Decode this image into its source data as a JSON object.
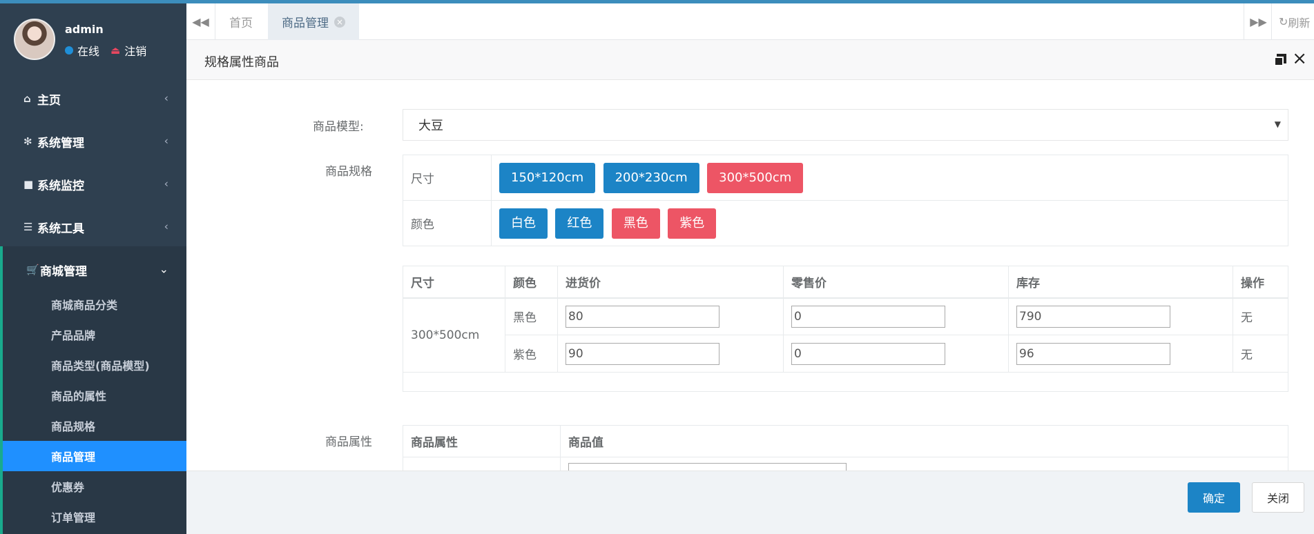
{
  "colors": {
    "sidebar_bg": "#2f4050",
    "active_item": "#1f90ff",
    "primary_button": "#1c84c6",
    "danger_button": "#ed5565"
  },
  "user": {
    "name": "admin",
    "status_online": "在线",
    "logout": "注销"
  },
  "sidebar": {
    "items": [
      {
        "label": "主页",
        "icon": "home-icon"
      },
      {
        "label": "系统管理",
        "icon": "gear-icon"
      },
      {
        "label": "系统监控",
        "icon": "video-camera-icon"
      },
      {
        "label": "系统工具",
        "icon": "list-icon"
      },
      {
        "label": "商城管理",
        "icon": "cart-icon"
      }
    ],
    "sub_items": [
      {
        "label": "商城商品分类"
      },
      {
        "label": "产品品牌"
      },
      {
        "label": "商品类型(商品模型)"
      },
      {
        "label": "商品的属性"
      },
      {
        "label": "商品规格"
      },
      {
        "label": "商品管理",
        "active": true
      },
      {
        "label": "优惠券"
      },
      {
        "label": "订单管理"
      }
    ]
  },
  "tabs": [
    {
      "label": "首页"
    },
    {
      "label": "商品管理",
      "active": true
    }
  ],
  "refresh_label": "刷新",
  "dialog": {
    "title": "规格属性商品",
    "model_label": "商品模型:",
    "model_value": "大豆",
    "spec_label": "商品规格",
    "specs": [
      {
        "name": "尺寸",
        "values": [
          {
            "label": "150*120cm",
            "selected": false
          },
          {
            "label": "200*230cm",
            "selected": false
          },
          {
            "label": "300*500cm",
            "selected": true
          }
        ]
      },
      {
        "name": "颜色",
        "values": [
          {
            "label": "白色",
            "selected": false
          },
          {
            "label": "红色",
            "selected": false
          },
          {
            "label": "黑色",
            "selected": true
          },
          {
            "label": "紫色",
            "selected": true
          }
        ]
      }
    ],
    "sku_table": {
      "headers": [
        "尺寸",
        "颜色",
        "进货价",
        "零售价",
        "库存",
        "操作"
      ],
      "size": "300*500cm",
      "rows": [
        {
          "color": "黑色",
          "cost": "80",
          "price": "0",
          "stock": "790",
          "op": "无"
        },
        {
          "color": "紫色",
          "cost": "90",
          "price": "0",
          "stock": "96",
          "op": "无"
        }
      ]
    },
    "attr_label": "商品属性",
    "attr_table": {
      "headers": [
        "商品属性",
        "商品值"
      ]
    },
    "ok_button": "确定",
    "close_button": "关闭"
  }
}
